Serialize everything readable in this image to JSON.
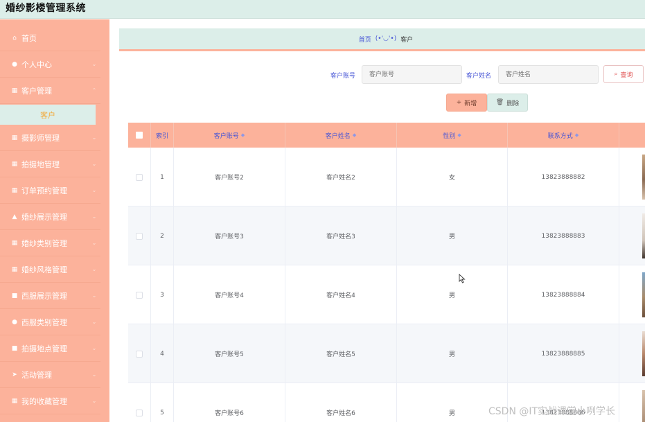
{
  "app": {
    "title": "婚纱影楼管理系统"
  },
  "sidebar": {
    "items": [
      {
        "label": "首页",
        "icon": "home-icon",
        "glyph": "⌂",
        "has_arrow": false
      },
      {
        "label": "个人中心",
        "icon": "user-icon",
        "glyph": "●",
        "has_arrow": true
      },
      {
        "label": "客户管理",
        "icon": "grid-icon",
        "glyph": "▦",
        "has_arrow": true
      },
      {
        "label": "摄影师管理",
        "icon": "grid-icon",
        "glyph": "▦",
        "has_arrow": true
      },
      {
        "label": "拍摄地管理",
        "icon": "grid-icon",
        "glyph": "▦",
        "has_arrow": true
      },
      {
        "label": "订单预约管理",
        "icon": "grid-icon",
        "glyph": "▦",
        "has_arrow": true
      },
      {
        "label": "婚纱展示管理",
        "icon": "thumb-icon",
        "glyph": "▲",
        "has_arrow": true
      },
      {
        "label": "婚纱类别管理",
        "icon": "grid-icon",
        "glyph": "▦",
        "has_arrow": true
      },
      {
        "label": "婚纱风格管理",
        "icon": "grid-icon",
        "glyph": "▦",
        "has_arrow": true
      },
      {
        "label": "西服展示管理",
        "icon": "briefcase-icon",
        "glyph": "■",
        "has_arrow": true
      },
      {
        "label": "西服类别管理",
        "icon": "user-icon",
        "glyph": "●",
        "has_arrow": true
      },
      {
        "label": "拍摄地点管理",
        "icon": "clipboard-icon",
        "glyph": "■",
        "has_arrow": true
      },
      {
        "label": "活动管理",
        "icon": "send-icon",
        "glyph": "➤",
        "has_arrow": true
      },
      {
        "label": "我的收藏管理",
        "icon": "grid-icon",
        "glyph": "▦",
        "has_arrow": true
      }
    ],
    "active_submenu": "客户"
  },
  "breadcrumb": {
    "home": "首页",
    "separator": "(•'◡'•)",
    "current": "客户"
  },
  "search": {
    "account_label": "客户账号",
    "account_placeholder": "客户账号",
    "name_label": "客户姓名",
    "name_placeholder": "客户姓名",
    "search_button": "查询"
  },
  "actions": {
    "add_label": "新增",
    "delete_label": "删除"
  },
  "table": {
    "columns": [
      "索引",
      "客户账号",
      "客户姓名",
      "性别",
      "联系方式"
    ],
    "rows": [
      {
        "index": "1",
        "account": "客户账号2",
        "name": "客户姓名2",
        "gender": "女",
        "phone": "13823888882"
      },
      {
        "index": "2",
        "account": "客户账号3",
        "name": "客户姓名3",
        "gender": "男",
        "phone": "13823888883"
      },
      {
        "index": "3",
        "account": "客户账号4",
        "name": "客户姓名4",
        "gender": "男",
        "phone": "13823888884"
      },
      {
        "index": "4",
        "account": "客户账号5",
        "name": "客户姓名5",
        "gender": "男",
        "phone": "13823888885"
      },
      {
        "index": "5",
        "account": "客户账号6",
        "name": "客户姓名6",
        "gender": "男",
        "phone": "13823888886"
      }
    ]
  },
  "watermark": "CSDN @IT实战课堂小咧学长",
  "colors": {
    "sidebar": "#fcb29b",
    "header_bg": "#dceee9",
    "accent_text": "#4755d6",
    "active_item": "#f2a93b"
  }
}
